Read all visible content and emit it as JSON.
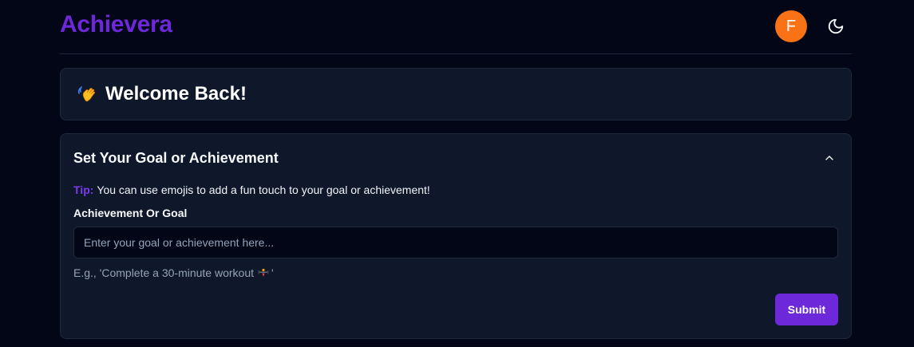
{
  "header": {
    "logo": "Achievera",
    "avatar_initial": "F",
    "theme_toggle_icon": "moon-icon"
  },
  "welcome": {
    "emoji_icon": "waving-hand-icon",
    "title": "Welcome Back!"
  },
  "goal_form": {
    "title": "Set Your Goal or Achievement",
    "collapse_icon": "chevron-up-icon",
    "tip_label": "Tip:",
    "tip_text": "You can use emojis to add a fun touch to your goal or achievement!",
    "field_label": "Achievement Or Goal",
    "input_value": "",
    "input_placeholder": "Enter your goal or achievement here...",
    "example_prefix": "E.g., 'Complete a 30-minute workout",
    "example_icon": "weight-lifter-icon",
    "example_suffix": "'",
    "submit_label": "Submit"
  },
  "colors": {
    "background": "#020617",
    "card": "#0f172a",
    "border": "#1e293b",
    "brand_purple": "#6d28d9",
    "tip_purple": "#7c3aed",
    "avatar_orange": "#f97316",
    "muted_text": "#94a3b8"
  }
}
